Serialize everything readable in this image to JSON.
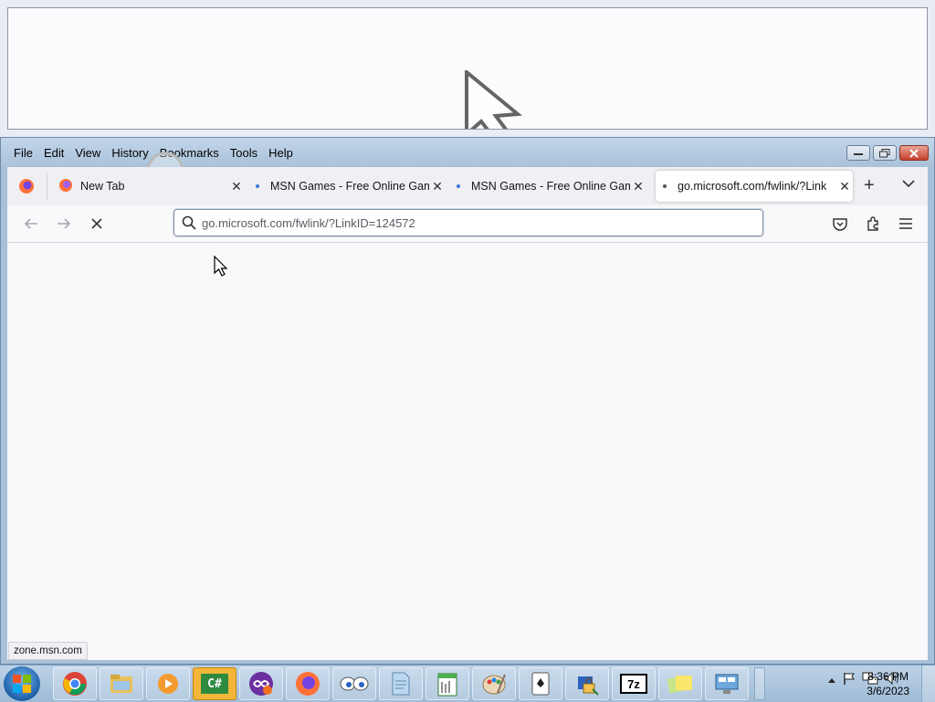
{
  "menu": {
    "file": "File",
    "edit": "Edit",
    "view": "View",
    "history": "History",
    "bookmarks": "Bookmarks",
    "tools": "Tools",
    "help": "Help"
  },
  "tabs": [
    {
      "label": "New Tab"
    },
    {
      "label": "MSN Games - Free Online Gam"
    },
    {
      "label": "MSN Games - Free Online Gam"
    },
    {
      "label": "go.microsoft.com/fwlink/?Link"
    }
  ],
  "urlbar": {
    "value": "go.microsoft.com/fwlink/?LinkID=124572"
  },
  "status": {
    "text": "zone.msn.com"
  },
  "clock": {
    "time": "8:36 PM",
    "date": "3/6/2023"
  },
  "taskbar": {
    "icons": [
      "chrome-icon",
      "file-explorer-icon",
      "media-player-icon",
      "csharp-icon",
      "animated-app-icon",
      "firefox-icon",
      "eyes-icon",
      "document-icon",
      "notepad-icon",
      "paint-icon",
      "solitaire-icon",
      "network-lock-icon",
      "7zip-icon",
      "sticky-notes-icon",
      "remote-desktop-icon"
    ],
    "sevenzip_label": "7z",
    "csharp_label": "C#"
  },
  "colors": {
    "accent": "#3b78d8",
    "titlebar": "#a9c1d9",
    "active_taskbar": "#f3b63a"
  }
}
